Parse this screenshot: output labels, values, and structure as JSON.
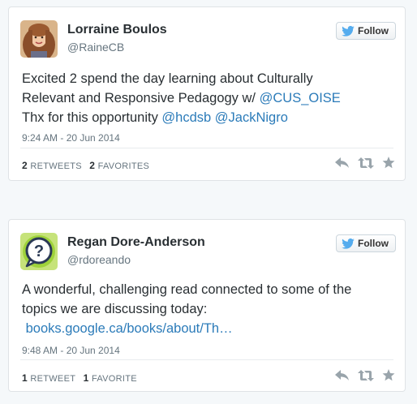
{
  "colors": {
    "link": "#2b7bb9",
    "name": "#292f33",
    "muted": "#66757f",
    "twitter_bird": "#55acee"
  },
  "tweets": [
    {
      "name": "Lorraine Boulos",
      "handle": "@RaineCB",
      "follow_label": "Follow",
      "text_lines": [
        [
          "Excited 2 spend the day learning about Culturally"
        ],
        [
          "Relevant and Responsive Pedagogy w/ ",
          "@CUS_OISE"
        ],
        [
          "Thx for this opportunity ",
          "@hcdsb",
          " ",
          "@JackNigro"
        ]
      ],
      "t1": "Excited 2 spend the day learning about Culturally",
      "t2a": "Relevant and Responsive Pedagogy w/ ",
      "t2b": "@CUS_OISE",
      "t3a": "Thx for this opportunity ",
      "t3b": "@hcdsb",
      "t3c": "@JackNigro",
      "date": "9:24 AM - 20 Jun 2014",
      "retweet_count": "2",
      "retweet_label": "RETWEETS",
      "favorite_count": "2",
      "favorite_label": "FAVORITES",
      "avatar_icon": "profile-photo"
    },
    {
      "name": "Regan Dore-Anderson",
      "handle": "@rdoreando",
      "follow_label": "Follow",
      "t1": "A wonderful, challenging read connected to some of the",
      "t2": "topics we are discussing today:",
      "t3": "books.google.ca/books/about/Th…",
      "date": "9:48 AM - 20 Jun 2014",
      "retweet_count": "1",
      "retweet_label": "RETWEET",
      "favorite_count": "1",
      "favorite_label": "FAVORITE",
      "avatar_icon": "question-mark-avatar-icon"
    }
  ]
}
